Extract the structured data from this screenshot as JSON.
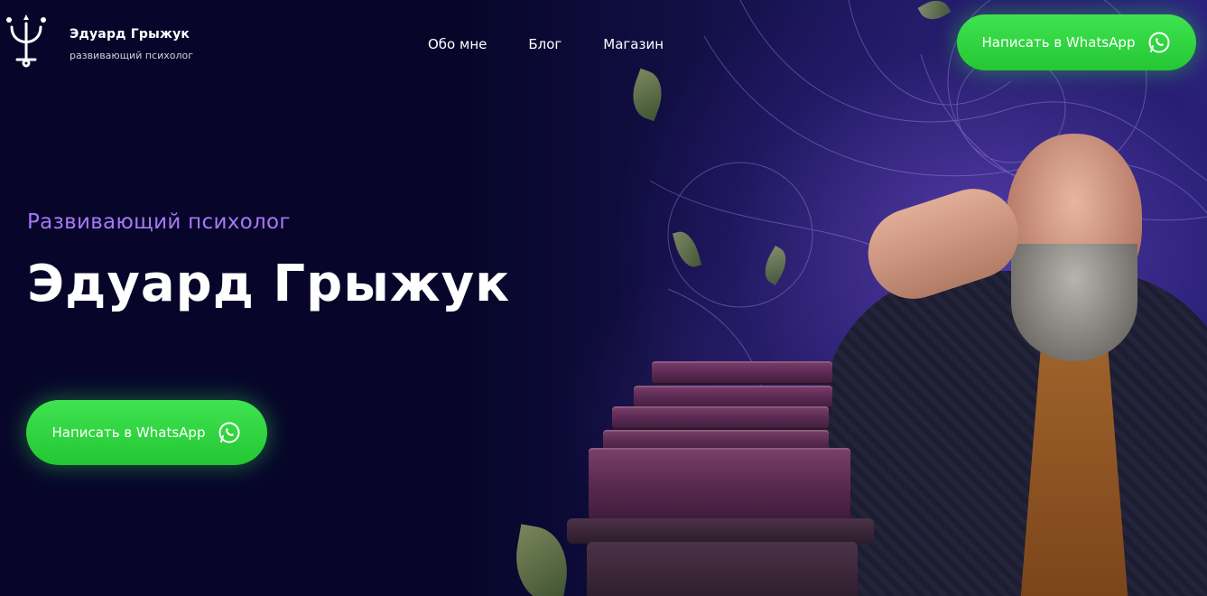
{
  "header": {
    "logo_icon": "psi-symbol-logo",
    "brand_name": "Эдуард Грыжук",
    "brand_subtitle": "развивающий психолог",
    "nav": [
      "Обо мне",
      "Блог",
      "Магазин"
    ],
    "cta_label": "Написать в WhatsApp",
    "cta_icon": "whatsapp-icon"
  },
  "hero": {
    "subtitle": "Развивающий психолог",
    "title": "Эдуард Грыжук",
    "cta_label": "Написать в WhatsApp",
    "cta_icon": "whatsapp-icon"
  },
  "colors": {
    "background": "#07062a",
    "accent_purple": "#a777f5",
    "whatsapp_green": "#2fd43f"
  }
}
